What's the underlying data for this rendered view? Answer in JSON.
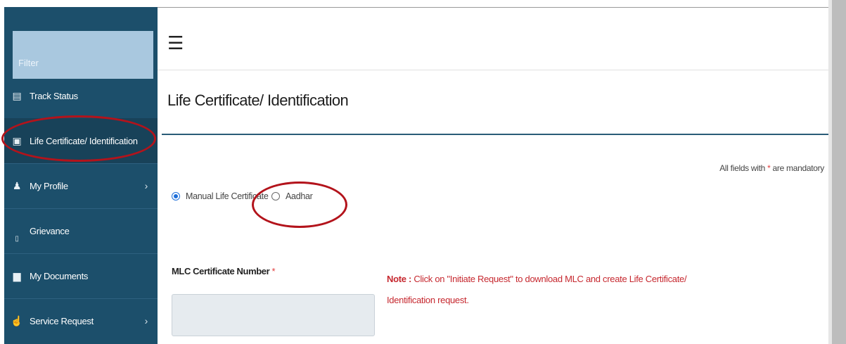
{
  "sidebar": {
    "filter_placeholder": "Filter",
    "items": [
      {
        "label": "Track Status",
        "icon": "list-icon"
      },
      {
        "label": "Life Certificate/ Identification",
        "icon": "id-card-icon"
      },
      {
        "label": "My Profile",
        "icon": "user-icon",
        "chevron": "›"
      },
      {
        "label": "Grievance",
        "icon": "grievance-icon"
      },
      {
        "label": "My Documents",
        "icon": "document-icon"
      },
      {
        "label": "Service Request",
        "icon": "hand-pointer-icon",
        "chevron": "›"
      }
    ]
  },
  "header": {
    "menu_icon": "☰"
  },
  "main": {
    "title": "Life Certificate/ Identification",
    "mandatory_text": "All fields with ",
    "mandatory_star": "*",
    "mandatory_suffix": " are mandatory",
    "radio_options": [
      {
        "label": "Manual Life Certificate",
        "checked": true
      },
      {
        "label": "Aadhar",
        "checked": false
      }
    ],
    "mlc_label": "MLC Certificate Number ",
    "mlc_star": "*",
    "mlc_value": "",
    "note_label": "Note :",
    "note_text": " Click on \"Initiate Request\" to download MLC and create Life Certificate/ Identification request."
  },
  "colors": {
    "sidebar_bg": "#1c4f6b",
    "filter_bg": "#a9c8df",
    "accent_rule": "#2a5c78",
    "note_red": "#c6282f",
    "highlight_ring": "#b3131b",
    "radio_blue": "#1e6fd9"
  }
}
